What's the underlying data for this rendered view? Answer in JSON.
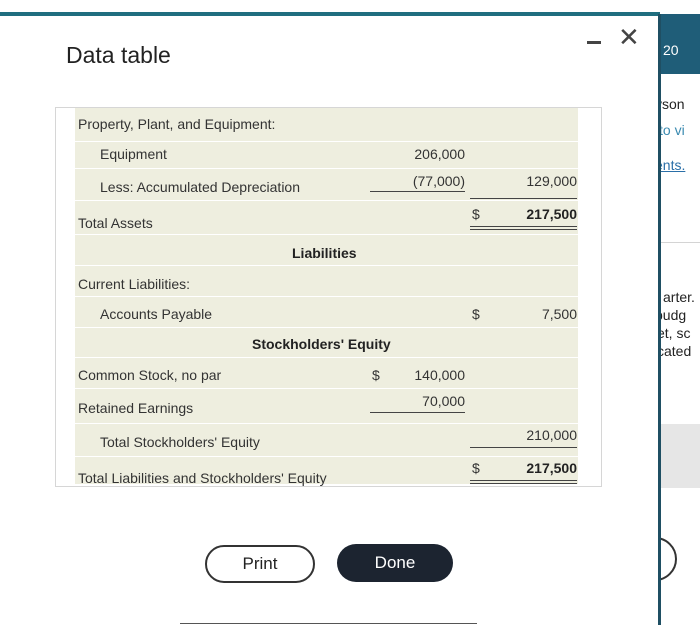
{
  "dialog": {
    "title": "Data table",
    "print_label": "Print",
    "done_label": "Done"
  },
  "background_page": {
    "badge": "20",
    "snippets": [
      "yson",
      "to vi",
      "ents.",
      "arter.",
      "budg",
      "et, sc",
      "cated"
    ]
  },
  "table": {
    "ppe_header": "Property, Plant, and Equipment:",
    "equipment_label": "Equipment",
    "equipment_value": "206,000",
    "accum_dep_label": "Less: Accumulated Depreciation",
    "accum_dep_value": "(77,000)",
    "net_ppe_value": "129,000",
    "total_assets_label": "Total Assets",
    "total_assets_currency": "$",
    "total_assets_value": "217,500",
    "liabilities_header": "Liabilities",
    "current_liabilities_label": "Current Liabilities:",
    "accounts_payable_label": "Accounts Payable",
    "accounts_payable_currency": "$",
    "accounts_payable_value": "7,500",
    "equity_header": "Stockholders' Equity",
    "common_stock_label": "Common Stock, no par",
    "common_stock_currency": "$",
    "common_stock_value": "140,000",
    "retained_earnings_label": "Retained Earnings",
    "retained_earnings_value": "70,000",
    "total_equity_label": "Total Stockholders' Equity",
    "total_equity_value": "210,000",
    "total_liab_equity_label": "Total Liabilities and Stockholders' Equity",
    "total_liab_equity_currency": "$",
    "total_liab_equity_value": "217,500"
  },
  "colors": {
    "accent": "#1f6e7f",
    "row_shade": "#eeeedf",
    "done_button": "#1c2430"
  }
}
